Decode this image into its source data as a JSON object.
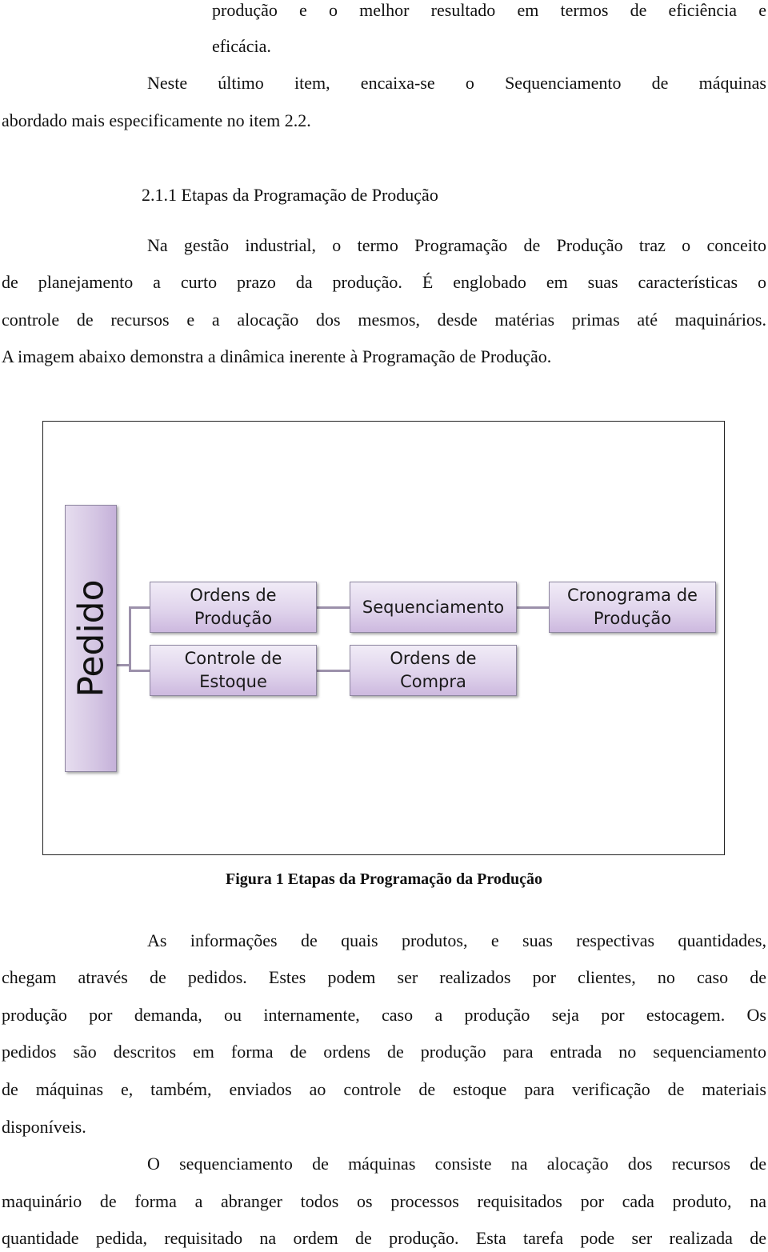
{
  "document": {
    "paragraph_continuation": {
      "lines": [
        "produção e o melhor resultado em termos de eficiência e",
        "eficácia."
      ]
    },
    "paragraph_neste": {
      "lines": [
        "Neste último item, encaixa-se o Sequenciamento de máquinas",
        "abordado mais especificamente no item 2.2."
      ]
    },
    "section_heading": "2.1.1 Etapas da Programação de Produção",
    "paragraph_gestao": {
      "lines": [
        "Na gestão industrial, o termo Programação de Produção traz o conceito",
        "de planejamento a curto prazo da produção. É englobado em suas características o",
        "controle de recursos e a alocação dos mesmos, desde matérias primas até maquinários.",
        "A imagem abaixo demonstra a dinâmica inerente à Programação de Produção."
      ]
    },
    "figure": {
      "caption": "Figura 1 Etapas da Programação da Produção",
      "root": "Pedido",
      "nodes": {
        "ordens_producao": "Ordens de Produção",
        "controle_estoque": "Controle de Estoque",
        "sequenciamento": "Sequenciamento",
        "ordens_compra": "Ordens de Compra",
        "cronograma": "Cronograma de Produção"
      },
      "edges": [
        [
          "Pedido",
          "Ordens de Produção"
        ],
        [
          "Pedido",
          "Controle de Estoque"
        ],
        [
          "Ordens de Produção",
          "Sequenciamento"
        ],
        [
          "Controle de Estoque",
          "Ordens de Compra"
        ],
        [
          "Sequenciamento",
          "Cronograma de Produção"
        ]
      ],
      "colors": {
        "box_fill_top": "#f1ecf7",
        "box_fill_bottom": "#cdb9df",
        "connector": "#9c91ab"
      }
    },
    "paragraph_informacoes": {
      "lines": [
        "As informações de quais produtos, e suas respectivas quantidades,",
        "chegam através de pedidos. Estes podem ser realizados por clientes, no caso de",
        "produção por demanda, ou internamente, caso a produção seja por estocagem. Os",
        "pedidos são descritos em forma de ordens de produção para entrada no sequenciamento",
        "de máquinas e, também, enviados ao controle de estoque para verificação de materiais",
        "disponíveis."
      ]
    },
    "paragraph_sequenciamento": {
      "lines": [
        "O sequenciamento de máquinas consiste na alocação dos recursos de",
        "maquinário de forma a abranger todos os processos requisitados por cada produto, na",
        "quantidade pedida, requisitado na ordem de produção. Esta tarefa pode ser realizada de"
      ]
    }
  }
}
